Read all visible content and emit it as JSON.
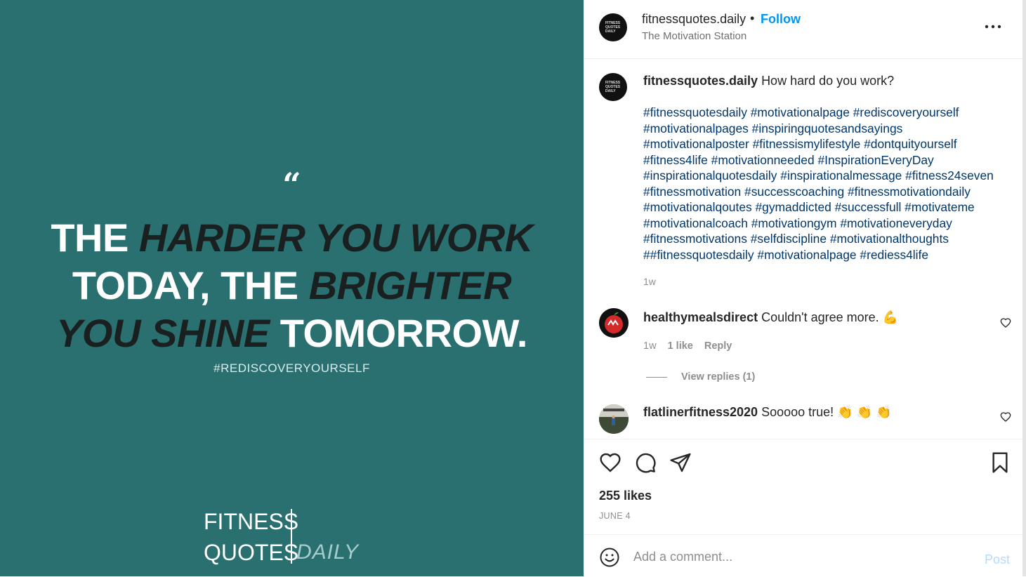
{
  "media": {
    "quote_mark": "“",
    "quote_lines": [
      [
        {
          "t": "THE ",
          "s": "w"
        },
        {
          "t": "HARDER YOU WORK",
          "s": "d"
        }
      ],
      [
        {
          "t": "TODAY, THE ",
          "s": "w"
        },
        {
          "t": "BRIGHTER",
          "s": "d"
        }
      ],
      [
        {
          "t": "YOU SHINE ",
          "s": "d"
        },
        {
          "t": "TOMORROW.",
          "s": "w"
        }
      ]
    ],
    "hashtag": "#REDISCOVERYOURSELF",
    "brand_line1": "FITNESS",
    "brand_line2": "QUOTES",
    "brand_line3": "DAILY",
    "colors": {
      "background": "#2b7070",
      "light": "#ffffff",
      "dark": "#1a1f1f"
    }
  },
  "header": {
    "username": "fitnessquotes.daily",
    "separator": "•",
    "follow_label": "Follow",
    "subtitle": "The Motivation Station",
    "more_icon": "more-horizontal-icon",
    "avatar_text": "FITNESS QUOTES DAILY"
  },
  "caption": {
    "username": "fitnessquotes.daily",
    "text": "How hard do you work?",
    "hashtag_lines": [
      "#fitnessquotesdaily #motivationalpage #rediscoveryourself",
      "#motivationalpages #inspiringquotesandsayings",
      "#motivationalposter #fitnessismylifestyle #dontquityourself",
      "#fitness4life #motivationneeded #InspirationEveryDay",
      "#inspirationalquotesdaily #inspirationalmessage #fitness24seven",
      "#fitnessmotivation #successcoaching #fitnessmotivationdaily",
      "#motivationalqoutes #gymaddicted #successfull #motivateme",
      "#motivationalcoach #motivationgym #motivationeveryday",
      "#fitnessmotivations #selfdiscipline #motivationalthoughts",
      "##fitnessquotesdaily #motivationalpage #rediess4life"
    ],
    "time": "1w"
  },
  "comments": [
    {
      "username": "healthymealsdirect",
      "text": "Couldn't agree more. 💪",
      "time": "1w",
      "likes": "1 like",
      "reply_label": "Reply",
      "view_replies": "View replies (1)"
    },
    {
      "username": "flatlinerfitness2020",
      "text": "Sooooo true! 👏 👏 👏"
    }
  ],
  "actions": {
    "like_icon": "heart-icon",
    "comment_icon": "comment-icon",
    "share_icon": "send-icon",
    "save_icon": "bookmark-icon",
    "likes_text": "255 likes",
    "date": "JUNE 4"
  },
  "add_comment": {
    "placeholder": "Add a comment...",
    "post_label": "Post",
    "emoji_icon": "emoji-icon"
  }
}
